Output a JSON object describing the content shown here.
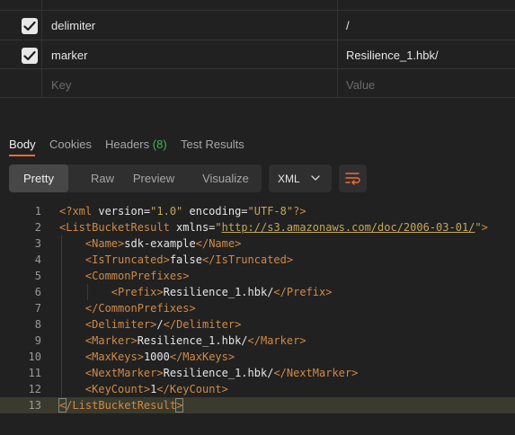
{
  "params": {
    "rows": [
      {
        "checked": true,
        "key": "delimiter",
        "value": "/"
      },
      {
        "checked": true,
        "key": "marker",
        "value": "Resilience_1.hbk/"
      }
    ],
    "new_row": {
      "key_placeholder": "Key",
      "value_placeholder": "Value"
    }
  },
  "response_tabs": {
    "body": "Body",
    "cookies": "Cookies",
    "headers": "Headers",
    "headers_count": "(8)",
    "test_results": "Test Results"
  },
  "view_modes": {
    "pretty": "Pretty",
    "raw": "Raw",
    "preview": "Preview",
    "visualize": "Visualize",
    "active": "Pretty"
  },
  "language": {
    "selected": "XML"
  },
  "colors": {
    "accent": "#f26b3a",
    "count_green": "#3fb950",
    "xml_tag": "#d08a46",
    "xml_string": "#c6a658"
  },
  "code": {
    "line_numbers": [
      "1",
      "2",
      "3",
      "4",
      "5",
      "6",
      "7",
      "8",
      "9",
      "10",
      "11",
      "12",
      "13"
    ],
    "l1": {
      "open": "<?xml",
      "attr1": " version=",
      "val1": "\"1.0\"",
      "attr2": " encoding=",
      "val2": "\"UTF-8\"",
      "close": "?>"
    },
    "l2": {
      "open": "<ListBucketResult",
      "attr": " xmlns=",
      "q1": "\"",
      "url": "http://s3.amazonaws.com/doc/2006-03-01/",
      "q2": "\"",
      "close": ">"
    },
    "l3": {
      "open": "<Name>",
      "text": "sdk-example",
      "close": "</Name>"
    },
    "l4": {
      "open": "<IsTruncated>",
      "text": "false",
      "close": "</IsTruncated>"
    },
    "l5": {
      "open": "<CommonPrefixes>"
    },
    "l6": {
      "open": "<Prefix>",
      "text": "Resilience_1.hbk/",
      "close": "</Prefix>"
    },
    "l7": {
      "close": "</CommonPrefixes>"
    },
    "l8": {
      "open": "<Delimiter>",
      "text": "/",
      "close": "</Delimiter>"
    },
    "l9": {
      "open": "<Marker>",
      "text": "Resilience_1.hbk/",
      "close": "</Marker>"
    },
    "l10": {
      "open": "<MaxKeys>",
      "text": "1000",
      "close": "</MaxKeys>"
    },
    "l11": {
      "open": "<NextMarker>",
      "text": "Resilience_1.hbk/",
      "close": "</NextMarker>"
    },
    "l12": {
      "open": "<KeyCount>",
      "text": "1",
      "close": "</KeyCount>"
    },
    "l13": {
      "lt": "<",
      "tag": "/ListBucketResult",
      "gt": ">"
    }
  }
}
